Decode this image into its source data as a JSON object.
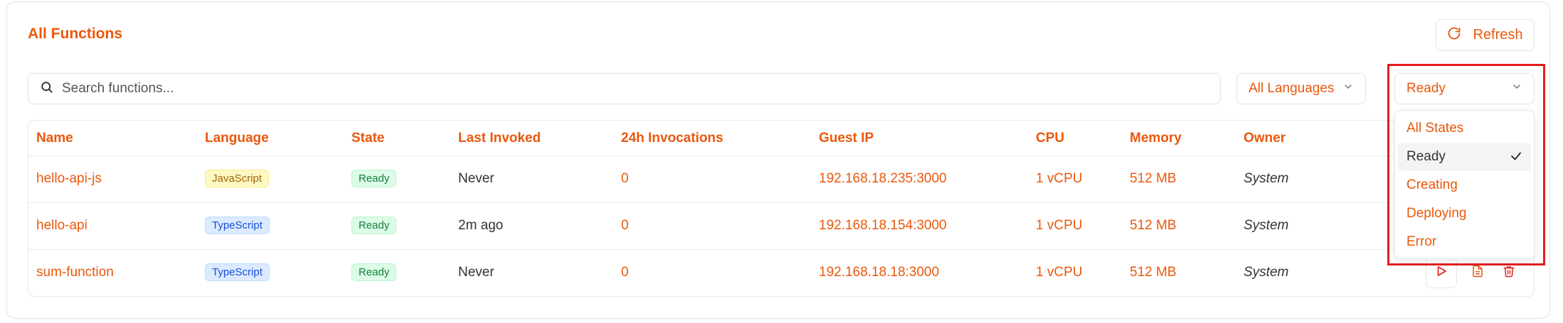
{
  "page": {
    "title": "All Functions"
  },
  "toolbar": {
    "refresh_label": "Refresh"
  },
  "search": {
    "placeholder": "Search functions..."
  },
  "filters": {
    "language": {
      "selected": "All Languages"
    },
    "state": {
      "selected": "Ready",
      "options": [
        "All States",
        "Ready",
        "Creating",
        "Deploying",
        "Error"
      ]
    }
  },
  "table": {
    "headers": [
      "Name",
      "Language",
      "State",
      "Last Invoked",
      "24h Invocations",
      "Guest IP",
      "CPU",
      "Memory",
      "Owner"
    ],
    "rows": [
      {
        "name": "hello-api-js",
        "language": "JavaScript",
        "state": "Ready",
        "last_invoked": "Never",
        "invocations": "0",
        "guest_ip": "192.168.18.235:3000",
        "cpu": "1 vCPU",
        "memory": "512 MB",
        "owner": "System"
      },
      {
        "name": "hello-api",
        "language": "TypeScript",
        "state": "Ready",
        "last_invoked": "2m ago",
        "invocations": "0",
        "guest_ip": "192.168.18.154:3000",
        "cpu": "1 vCPU",
        "memory": "512 MB",
        "owner": "System"
      },
      {
        "name": "sum-function",
        "language": "TypeScript",
        "state": "Ready",
        "last_invoked": "Never",
        "invocations": "0",
        "guest_ip": "192.168.18.18:3000",
        "cpu": "1 vCPU",
        "memory": "512 MB",
        "owner": "System"
      }
    ]
  },
  "icons": {
    "refresh": "refresh-icon",
    "search": "search-icon",
    "chevron": "chevron-down-icon",
    "check": "check-icon",
    "run": "play-icon",
    "logs": "document-icon",
    "delete": "trash-icon"
  },
  "colors": {
    "accent": "#ea580c",
    "highlight": "#e11d1d",
    "ready": "#15803d"
  }
}
